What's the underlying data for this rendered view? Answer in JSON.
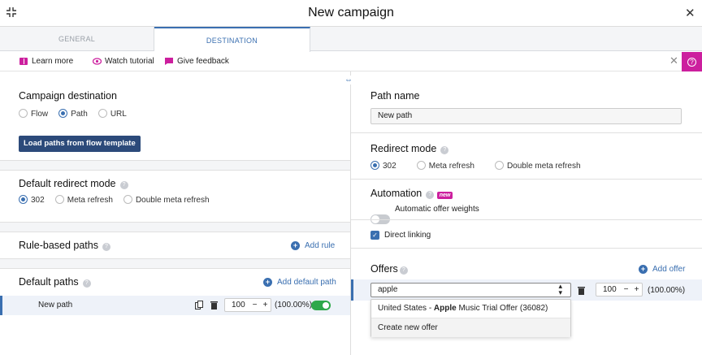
{
  "header": {
    "title": "New campaign"
  },
  "tabs": [
    {
      "label": "GENERAL"
    },
    {
      "label": "DESTINATION"
    }
  ],
  "helpbar": {
    "learn_more": "Learn more",
    "watch_tutorial": "Watch tutorial",
    "give_feedback": "Give feedback",
    "help_button": "?"
  },
  "left": {
    "campaign_destination": {
      "title": "Campaign destination",
      "options": [
        "Flow",
        "Path",
        "URL"
      ],
      "selected": "Path",
      "load_button": "Load paths from flow template"
    },
    "default_redirect_mode": {
      "title": "Default redirect mode",
      "options": [
        "302",
        "Meta refresh",
        "Double meta refresh"
      ],
      "selected": "302"
    },
    "rule_based_paths": {
      "title": "Rule-based paths",
      "add_label": "Add rule"
    },
    "default_paths": {
      "title": "Default paths",
      "add_label": "Add default path",
      "row": {
        "name": "New path",
        "weight": "100",
        "percent": "(100.00%)",
        "enabled": true
      }
    }
  },
  "right": {
    "path_name": {
      "title": "Path name",
      "value": "New path"
    },
    "redirect_mode": {
      "title": "Redirect mode",
      "options": [
        "302",
        "Meta refresh",
        "Double meta refresh"
      ],
      "selected": "302"
    },
    "automation": {
      "title": "Automation",
      "badge": "new",
      "toggle_label": "Automatic offer weights",
      "toggle_on": false
    },
    "direct_linking": {
      "label": "Direct linking",
      "checked": true
    },
    "offers": {
      "title": "Offers",
      "add_label": "Add offer",
      "row": {
        "search_value": "apple",
        "weight": "100",
        "percent": "(100.00%)"
      },
      "dropdown": {
        "result_prefix": "United States - ",
        "result_bold": "Apple",
        "result_suffix": " Music Trial Offer (36082)",
        "create_label": "Create new offer"
      }
    }
  },
  "colors": {
    "accent": "#3a6fb0",
    "brand_magenta": "#cc1f9e",
    "toggle_green": "#2ea84a",
    "button_navy": "#2c4a7a"
  }
}
